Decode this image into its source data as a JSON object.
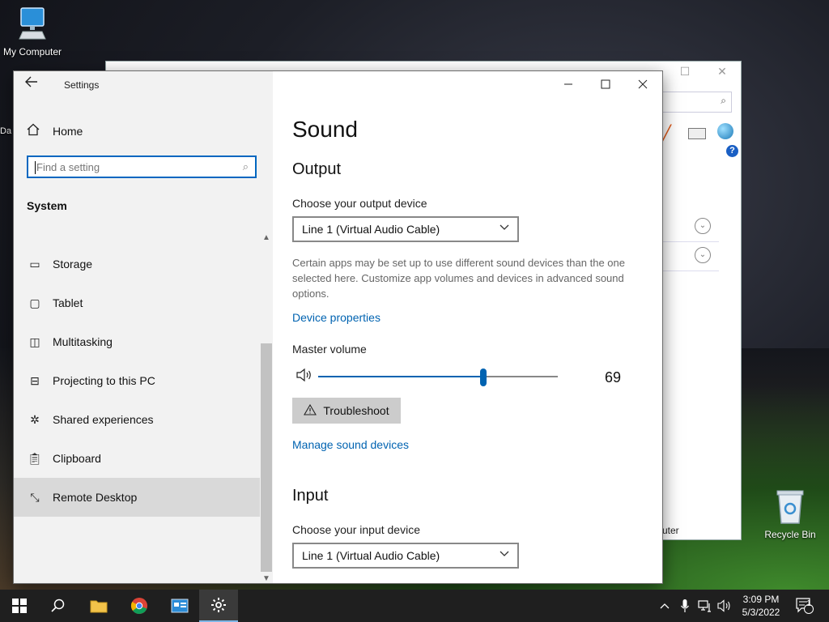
{
  "desktop": {
    "icons": [
      {
        "label": "My Computer"
      },
      {
        "label": "Recycle Bin"
      }
    ],
    "partial_label": "Da"
  },
  "background_window": {
    "status_text": "uter"
  },
  "settings": {
    "title": "Settings",
    "home_label": "Home",
    "search_placeholder": "Find a setting",
    "section_label": "System",
    "nav_items": [
      {
        "label": "Storage",
        "icon": "storage-icon"
      },
      {
        "label": "Tablet",
        "icon": "tablet-icon"
      },
      {
        "label": "Multitasking",
        "icon": "multitasking-icon"
      },
      {
        "label": "Projecting to this PC",
        "icon": "projecting-icon"
      },
      {
        "label": "Shared experiences",
        "icon": "shared-experiences-icon"
      },
      {
        "label": "Clipboard",
        "icon": "clipboard-icon"
      },
      {
        "label": "Remote Desktop",
        "icon": "remote-desktop-icon",
        "selected": true
      }
    ],
    "page_title": "Sound",
    "output": {
      "heading": "Output",
      "device_label": "Choose your output device",
      "device_value": "Line 1 (Virtual Audio Cable)",
      "description": "Certain apps may be set up to use different sound devices than the one selected here. Customize app volumes and devices in advanced sound options.",
      "device_properties_link": "Device properties",
      "master_volume_label": "Master volume",
      "volume_value": "69",
      "volume_level": 69,
      "troubleshoot_label": "Troubleshoot",
      "manage_devices_link": "Manage sound devices"
    },
    "input": {
      "heading": "Input",
      "device_label": "Choose your input device",
      "device_value": "Line 1 (Virtual Audio Cable)"
    }
  },
  "taskbar": {
    "time": "3:09 PM",
    "date": "5/3/2022",
    "notification_count": "1"
  },
  "colors": {
    "accent": "#0063b1",
    "search_border": "#0067c0",
    "sidebar_bg": "#f2f2f2",
    "selected_bg": "#d9d9d9"
  }
}
